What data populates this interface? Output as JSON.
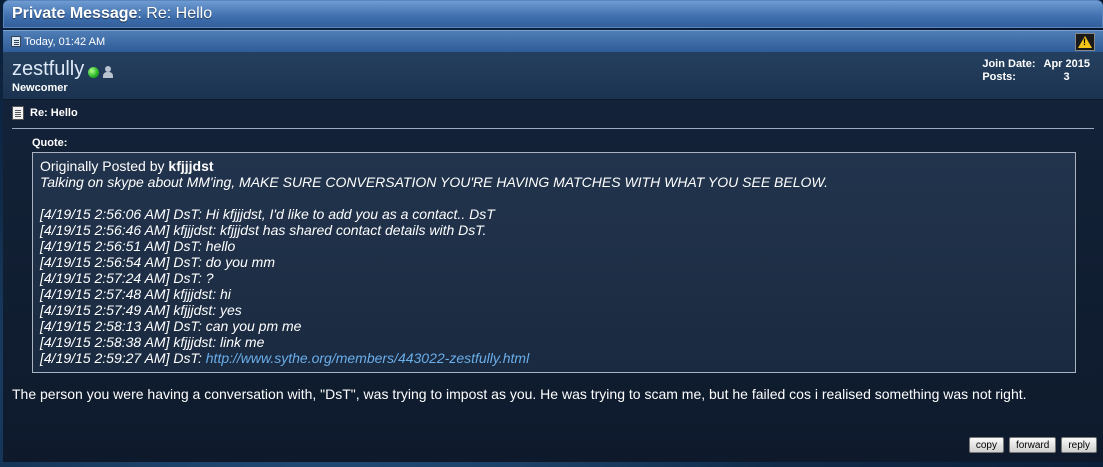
{
  "header": {
    "title_strong": "Private Message",
    "title_rest": ": Re: Hello"
  },
  "post": {
    "date": "Today, 01:42 AM",
    "username": "zestfully",
    "user_title": "Newcomer",
    "join_date_label": "Join Date:",
    "join_date_value": "Apr 2015",
    "posts_label": "Posts:",
    "posts_value": "3",
    "message_title": "Re: Hello",
    "quote_label": "Quote:",
    "quote_author_prefix": "Originally Posted by ",
    "quote_author": "kfjjjdst",
    "quote_lines_top": [
      "Talking on skype about MM'ing, MAKE SURE CONVERSATION YOU'RE HAVING MATCHES WITH WHAT YOU SEE BELOW."
    ],
    "quote_lines": [
      "[4/19/15 2:56:06 AM] DsT: Hi kfjjjdst, I'd like to add you as a contact.. DsT",
      "[4/19/15 2:56:46 AM] kfjjjdst: kfjjjdst has shared contact details with DsT.",
      "[4/19/15 2:56:51 AM] DsT: hello",
      "[4/19/15 2:56:54 AM] DsT: do you mm",
      "[4/19/15 2:57:24 AM] DsT: ?",
      "[4/19/15 2:57:48 AM] kfjjjdst: hi",
      "[4/19/15 2:57:49 AM] kfjjjdst: yes",
      "[4/19/15 2:58:13 AM] DsT: can you pm me",
      "[4/19/15 2:58:38 AM] kfjjjdst: link me"
    ],
    "quote_last_prefix": "[4/19/15 2:59:27 AM] DsT: ",
    "quote_link": "http://www.sythe.org/members/443022-zestfully.html",
    "message_text": "The person you were having a conversation with, \"DsT\", was trying to impost as you. He was trying to scam me, but he failed cos i realised something was not right."
  },
  "actions": {
    "copy": "copy",
    "forward": "forward",
    "reply": "reply"
  },
  "icons": [
    "post-icon",
    "warning-icon",
    "online-status-icon",
    "person-icon",
    "message-title-icon"
  ]
}
